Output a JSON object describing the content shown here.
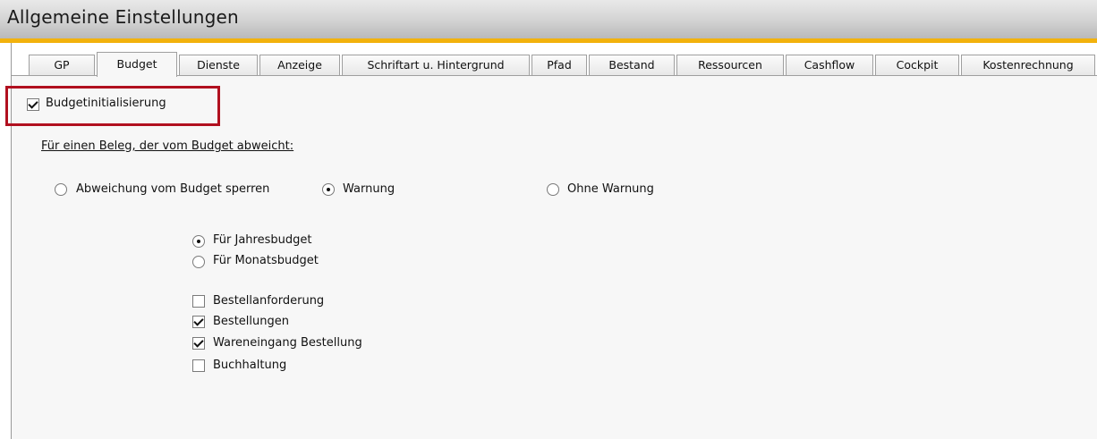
{
  "window": {
    "title": "Allgemeine Einstellungen"
  },
  "tabs": [
    {
      "label": "GP",
      "active": false
    },
    {
      "label": "Budget",
      "active": true
    },
    {
      "label": "Dienste",
      "active": false
    },
    {
      "label": "Anzeige",
      "active": false
    },
    {
      "label": "Schriftart u. Hintergrund",
      "active": false
    },
    {
      "label": "Pfad",
      "active": false
    },
    {
      "label": "Bestand",
      "active": false
    },
    {
      "label": "Ressourcen",
      "active": false
    },
    {
      "label": "Cashflow",
      "active": false
    },
    {
      "label": "Cockpit",
      "active": false
    },
    {
      "label": "Kostenrechnung",
      "active": false
    }
  ],
  "budget": {
    "init_label": "Budgetinitialisierung",
    "init_checked": true,
    "section_label": "Für einen Beleg, der vom Budget abweicht:",
    "deviation_options": [
      {
        "label": "Abweichung vom Budget sperren",
        "selected": false
      },
      {
        "label": "Warnung",
        "selected": true
      },
      {
        "label": "Ohne Warnung",
        "selected": false
      }
    ],
    "period_options": [
      {
        "label": "Für Jahresbudget",
        "selected": true
      },
      {
        "label": "Für Monatsbudget",
        "selected": false
      }
    ],
    "documents": [
      {
        "label": "Bestellanforderung",
        "checked": false
      },
      {
        "label": "Bestellungen",
        "checked": true
      },
      {
        "label": "Wareneingang Bestellung",
        "checked": true
      },
      {
        "label": "Buchhaltung",
        "checked": false
      }
    ]
  },
  "colors": {
    "accent": "#f2b20d",
    "highlight": "#b1101f",
    "pane": "#f7f7f7"
  }
}
